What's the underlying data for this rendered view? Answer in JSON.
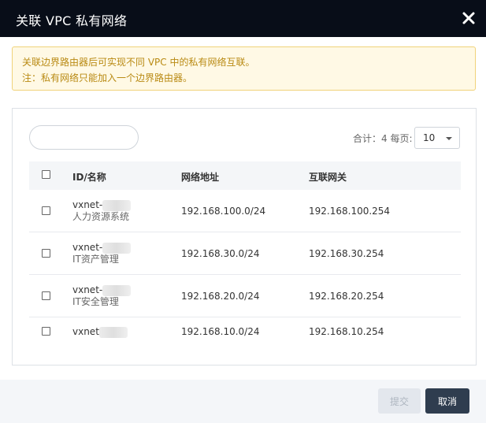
{
  "dialog": {
    "title": "关联 VPC 私有网络"
  },
  "notice": {
    "line1": "关联边界路由器后可实现不同 VPC 中的私有网络互联。",
    "line2": "注：私有网络只能加入一个边界路由器。"
  },
  "toolbar": {
    "search_value": "",
    "total_label": "合计：4  每页:",
    "page_size": "10"
  },
  "table": {
    "headers": {
      "id_name": "ID/名称",
      "network": "网络地址",
      "gateway": "互联网关"
    },
    "rows": [
      {
        "id": "vxnet-",
        "name": "人力资源系统",
        "network": "192.168.100.0/24",
        "gateway": "192.168.100.254"
      },
      {
        "id": "vxnet-",
        "name": "IT资产管理",
        "network": "192.168.30.0/24",
        "gateway": "192.168.30.254"
      },
      {
        "id": "vxnet-",
        "name": "IT安全管理",
        "network": "192.168.20.0/24",
        "gateway": "192.168.20.254"
      },
      {
        "id": "vxnet",
        "name": "",
        "network": "192.168.10.0/24",
        "gateway": "192.168.10.254"
      }
    ]
  },
  "footer": {
    "submit_label": "提交",
    "cancel_label": "取消"
  }
}
